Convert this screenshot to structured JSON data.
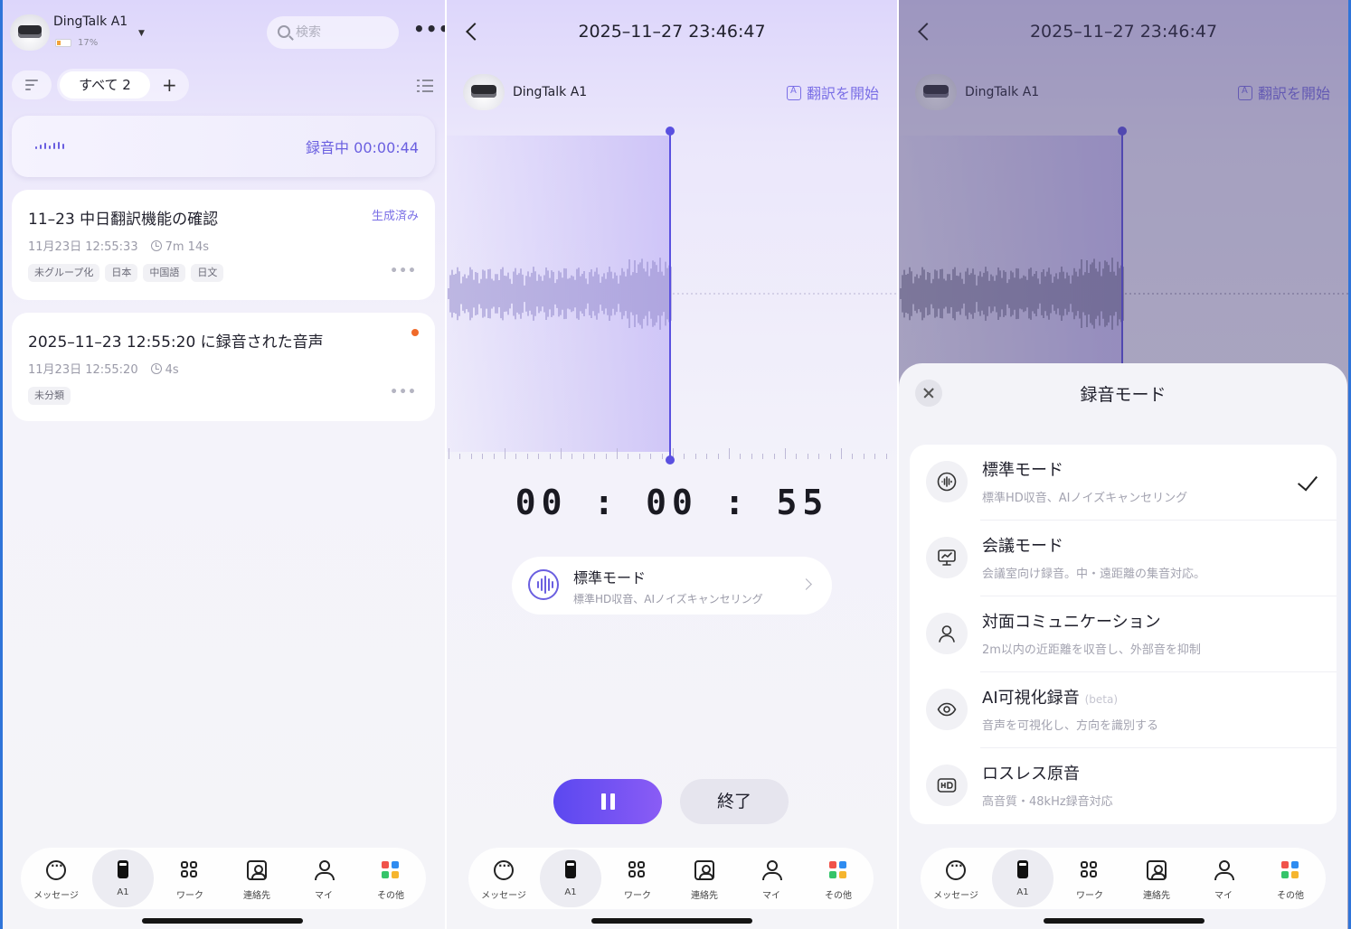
{
  "colors": {
    "accent": "#6a5fe0",
    "playhead": "#5a50e0",
    "recording_dot": "#f06a2a",
    "frame": "#2f74d9"
  },
  "list_screen": {
    "device_name": "DingTalk A1",
    "battery": "17%",
    "search_placeholder": "検索",
    "filter_chip": "すべて 2",
    "add_label": "+",
    "recording": {
      "text": "録音中 00:00:44"
    },
    "cards": [
      {
        "title": "11–23 中日翻訳機能の確認",
        "status": "生成済み",
        "date": "11月23日 12:55:33",
        "duration": "7m 14s",
        "tags": [
          "未グループ化",
          "日本",
          "中国語",
          "日文"
        ]
      },
      {
        "title": "2025–11–23 12:55:20 に録音された音声",
        "date": "11月23日 12:55:20",
        "duration": "4s",
        "tags": [
          "未分類"
        ]
      }
    ]
  },
  "recording_screen": {
    "title": "2025–11–27 23:46:47",
    "device_name": "DingTalk A1",
    "translate": "翻訳を開始",
    "timer": "00 : 00 : 55",
    "mode_name": "標準モード",
    "mode_desc": "標準HD収音、AIノイズキャンセリング",
    "stop": "終了"
  },
  "mode_sheet": {
    "title": "録音モード",
    "modes": [
      {
        "name": "標準モード",
        "desc": "標準HD収音、AIノイズキャンセリング",
        "icon": "waveform-icon",
        "selected": true
      },
      {
        "name": "会議モード",
        "desc": "会議室向け録音。中・遠距離の集音対応。",
        "icon": "presentation-icon"
      },
      {
        "name": "対面コミュニケーション",
        "desc": "2m以内の近距離を収音し、外部音を抑制",
        "icon": "person-icon"
      },
      {
        "name": "AI可視化録音",
        "beta": "(beta)",
        "desc": "音声を可視化し、方向を識別する",
        "icon": "eye-icon"
      },
      {
        "name": "ロスレス原音",
        "desc": "高音質・48kHz録音対応",
        "icon": "hd-icon"
      }
    ]
  },
  "nav": [
    {
      "label": "メッセージ",
      "icon": "chat-icon"
    },
    {
      "label": "A1",
      "icon": "device-icon",
      "active": true
    },
    {
      "label": "ワーク",
      "icon": "grid-icon"
    },
    {
      "label": "連絡先",
      "icon": "contact-card-icon"
    },
    {
      "label": "マイ",
      "icon": "person-icon"
    },
    {
      "label": "その他",
      "icon": "apps-icon"
    }
  ]
}
